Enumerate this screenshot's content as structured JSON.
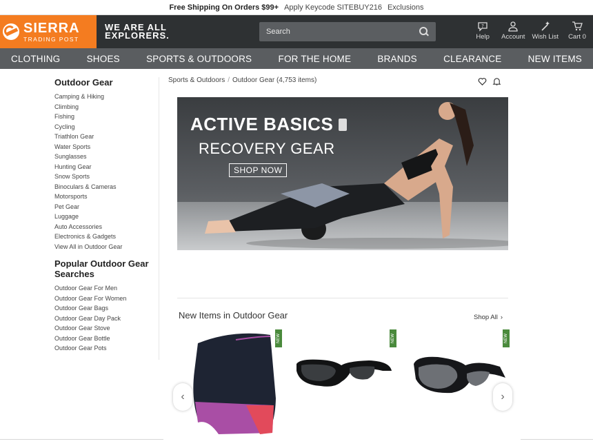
{
  "promo": {
    "shipping": "Free Shipping On Orders $99+",
    "keycode": "Apply Keycode SITEBUY216",
    "exclusions": "Exclusions"
  },
  "header": {
    "logo_main": "SIERRA",
    "logo_sub": "TRADING POST",
    "tagline_1": "WE ARE ALL",
    "tagline_2": "EXPLORERS.",
    "search_placeholder": "Search",
    "links": {
      "help": "Help",
      "account": "Account",
      "wishlist": "Wish List",
      "cart": "Cart 0"
    }
  },
  "nav": [
    "CLOTHING",
    "SHOES",
    "SPORTS & OUTDOORS",
    "FOR THE HOME",
    "BRANDS",
    "CLEARANCE",
    "NEW ITEMS"
  ],
  "sidebar": {
    "heading": "Outdoor Gear",
    "items": [
      "Camping & Hiking",
      "Climbing",
      "Fishing",
      "Cycling",
      "Triathlon Gear",
      "Water Sports",
      "Sunglasses",
      "Hunting Gear",
      "Snow Sports",
      "Binoculars & Cameras",
      "Motorsports",
      "Pet Gear",
      "Luggage",
      "Auto Accessories",
      "Electronics & Gadgets",
      "View All in Outdoor Gear"
    ],
    "popular_heading": "Popular Outdoor Gear Searches",
    "popular": [
      "Outdoor Gear For Men",
      "Outdoor Gear For Women",
      "Outdoor Gear Bags",
      "Outdoor Gear Day Pack",
      "Outdoor Gear Stove",
      "Outdoor Gear Bottle",
      "Outdoor Gear Pots"
    ]
  },
  "breadcrumb": {
    "parent": "Sports & Outdoors",
    "separator": "/",
    "current": "Outdoor Gear (4,753 items)"
  },
  "banner": {
    "title": "ACTIVE BASICS",
    "subtitle": "RECOVERY GEAR",
    "cta": "SHOP NOW"
  },
  "new_items": {
    "heading": "New Items in Outdoor Gear",
    "shop_all": "Shop All",
    "tag": "NEW"
  },
  "colors": {
    "brand_orange": "#f47c20",
    "header_dark": "#2e3133",
    "nav_gray": "#5a5d60"
  }
}
